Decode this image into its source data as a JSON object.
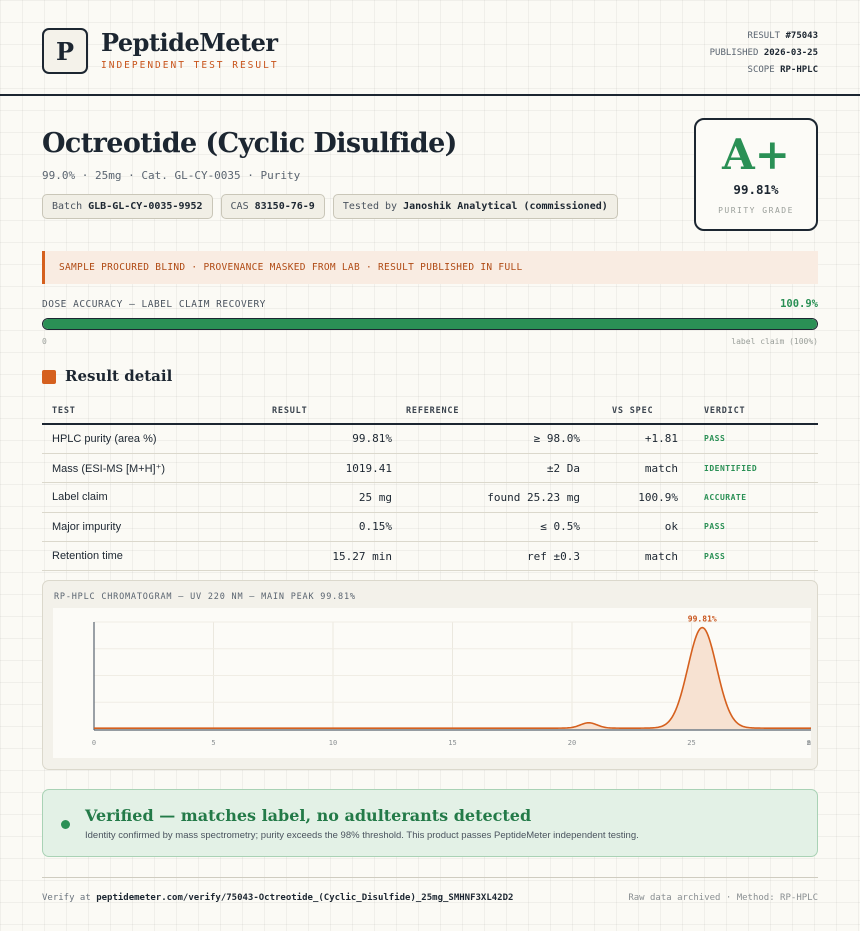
{
  "brand": {
    "logo_letter": "P",
    "name": "PeptideMeter",
    "tagline": "INDEPENDENT TEST RESULT"
  },
  "meta": {
    "result_label": "RESULT",
    "result_value": "#75043",
    "published_label": "PUBLISHED",
    "published_value": "2026-03-25",
    "scope_label": "SCOPE",
    "scope_value": "RP-HPLC"
  },
  "product": {
    "title": "Octreotide (Cyclic Disulfide)",
    "subtitle": "99.0% · 25mg · Cat. GL-CY-0035 · Purity",
    "chips": [
      {
        "label": "Batch",
        "value": "GLB-GL-CY-0035-9952"
      },
      {
        "label": "CAS",
        "value": "83150-76-9"
      },
      {
        "label": "Tested by",
        "value": "Janoshik Analytical (commissioned)"
      }
    ]
  },
  "grade": {
    "letter": "A+",
    "value": "99.81%",
    "label": "PURITY GRADE"
  },
  "notice": "SAMPLE PROCURED BLIND · PROVENANCE MASKED FROM LAB · RESULT PUBLISHED IN FULL",
  "dose": {
    "label": "DOSE ACCURACY — LABEL CLAIM RECOVERY",
    "value_text": "100.9%",
    "fill_fraction": 1.0,
    "min_label": "0",
    "max_label": "label claim (100%)"
  },
  "result_detail": {
    "title": "Result detail",
    "columns": [
      "TEST",
      "RESULT",
      "REFERENCE",
      "VS SPEC",
      "VERDICT"
    ],
    "rows": [
      {
        "test": "HPLC purity (area %)",
        "result": "99.81%",
        "reference": "≥ 98.0%",
        "vs_spec": "+1.81",
        "verdict": "PASS"
      },
      {
        "test": "Mass (ESI-MS [M+H]⁺)",
        "result": "1019.41",
        "reference": "±2 Da",
        "vs_spec": "match",
        "verdict": "IDENTIFIED"
      },
      {
        "test": "Label claim",
        "result": "25 mg",
        "reference": "found 25.23 mg",
        "vs_spec": "100.9%",
        "verdict": "ACCURATE"
      },
      {
        "test": "Major impurity",
        "result": "0.15%",
        "reference": "≤ 0.5%",
        "vs_spec": "ok",
        "verdict": "PASS"
      },
      {
        "test": "Retention time",
        "result": "15.27 min",
        "reference": "ref ±0.3",
        "vs_spec": "match",
        "verdict": "PASS"
      }
    ]
  },
  "chart_data": {
    "type": "line",
    "title": "RP-HPLC CHROMATOGRAM — UV 220 NM — MAIN PEAK 99.81%",
    "xlabel": "",
    "ylabel": "",
    "xlim": [
      0,
      30
    ],
    "ylim": [
      0,
      100
    ],
    "x_ticks": [
      "0",
      "5",
      "10",
      "15",
      "20",
      "25",
      "30",
      "min"
    ],
    "baseline": 0.8,
    "peaks": [
      {
        "x": 20.7,
        "height": 5,
        "width": 0.35
      },
      {
        "x": 25.45,
        "height": 94,
        "width": 0.6
      }
    ],
    "annotations": [
      {
        "x": 25.45,
        "text": "99.81%"
      }
    ],
    "line_color": "#d5601e",
    "fill_color": "#f7e2d2"
  },
  "verified": {
    "title": "Verified — matches label, no adulterants detected",
    "description": "Identity confirmed by mass spectrometry; purity exceeds the 98% threshold. This product passes PeptideMeter independent testing."
  },
  "footer": {
    "verify_prefix": "Verify at",
    "verify_url": "peptidemeter.com/verify/75043-Octreotide_(Cyclic_Disulfide)_25mg_SMHNF3XL42D2",
    "right_text": "Raw data archived · Method: RP-HPLC"
  }
}
